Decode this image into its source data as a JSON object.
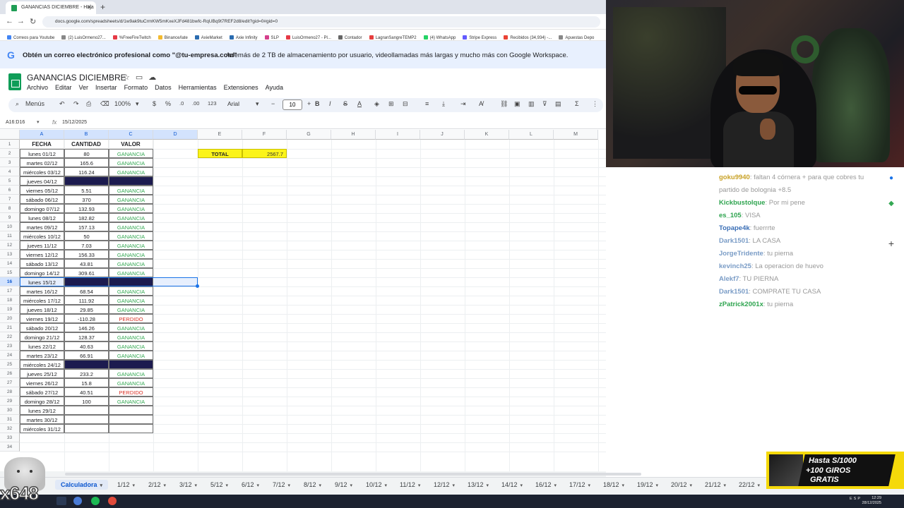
{
  "browser": {
    "tab_title": "GANANCIAS DICIEMBRE - Hoja",
    "url": "docs.google.com/spreadsheets/d/1w9ak9tuCrmKW5mKxeXJFd481bwfc-RqUBq9t7REF2d8/edit?gid=0#gid=0",
    "bookmarks": [
      {
        "label": "Correos para Youtube",
        "color": "#4285f4"
      },
      {
        "label": "(2) LuisOrmeno27...",
        "color": "#888888"
      },
      {
        "label": "%FreeFireTwitch",
        "color": "#e63946"
      },
      {
        "label": "Binance/late",
        "color": "#f3ba2f"
      },
      {
        "label": "AxieMarket",
        "color": "#2b6cb0"
      },
      {
        "label": "Axie Infinity",
        "color": "#2b6cb0"
      },
      {
        "label": "SLP",
        "color": "#d53f8c"
      },
      {
        "label": "LuisOrmeno27 - Pl...",
        "color": "#e63946"
      },
      {
        "label": "Contador",
        "color": "#666666"
      },
      {
        "label": "LagranSangreTEMP2",
        "color": "#e53e3e"
      },
      {
        "label": "(4) WhatsApp",
        "color": "#25d366"
      },
      {
        "label": "Stripe Express",
        "color": "#635bff"
      },
      {
        "label": "Recibidos (34,934) -...",
        "color": "#ea4335"
      },
      {
        "label": "Apuestas Depo",
        "color": "#888888"
      }
    ]
  },
  "promo": {
    "line1": "Obtén un correo electrónico profesional como \"@tu-empresa.com\"",
    "line2": "Además de 2 TB de almacenamiento por usuario, videollamadas más largas y mucho más con Google Workspace."
  },
  "sheets": {
    "title": "GANANCIAS DICIEMBRE",
    "menu": [
      "Archivo",
      "Editar",
      "Ver",
      "Insertar",
      "Formato",
      "Datos",
      "Herramientas",
      "Extensiones",
      "Ayuda"
    ],
    "toolbar": {
      "menus": "Menús",
      "zoom": "100%",
      "currency": "$",
      "percent": "%",
      "dec_less": ".0",
      "dec_more": ".00",
      "format_123": "123",
      "font": "Arial",
      "font_size": "10",
      "bold": "B",
      "italic": "I",
      "strike": "S",
      "text_color": "A"
    },
    "name_box": "A16:D16",
    "formula_value": "15/12/2025",
    "columns": [
      "A",
      "B",
      "C",
      "D",
      "E",
      "F",
      "G",
      "H",
      "I",
      "J",
      "K",
      "L",
      "M"
    ],
    "headers": {
      "fecha": "FECHA",
      "cantidad": "CANTIDAD",
      "valor": "VALOR"
    },
    "total_label": "TOTAL",
    "total_value": "2567.7",
    "rows": [
      {
        "fecha": "lunes 01/12",
        "cantidad": "80",
        "valor": "GANANCIA",
        "status": "gan"
      },
      {
        "fecha": "martes 02/12",
        "cantidad": "165.6",
        "valor": "GANANCIA",
        "status": "gan"
      },
      {
        "fecha": "miércoles 03/12",
        "cantidad": "116.24",
        "valor": "GANANCIA",
        "status": "gan"
      },
      {
        "fecha": "jueves 04/12",
        "cantidad": "",
        "valor": "",
        "status": "dark"
      },
      {
        "fecha": "viernes 05/12",
        "cantidad": "5.51",
        "valor": "GANANCIA",
        "status": "gan"
      },
      {
        "fecha": "sábado 06/12",
        "cantidad": "370",
        "valor": "GANANCIA",
        "status": "gan"
      },
      {
        "fecha": "domingo 07/12",
        "cantidad": "132.93",
        "valor": "GANANCIA",
        "status": "gan"
      },
      {
        "fecha": "lunes 08/12",
        "cantidad": "182.82",
        "valor": "GANANCIA",
        "status": "gan"
      },
      {
        "fecha": "martes 09/12",
        "cantidad": "157.13",
        "valor": "GANANCIA",
        "status": "gan"
      },
      {
        "fecha": "miércoles 10/12",
        "cantidad": "50",
        "valor": "GANANCIA",
        "status": "gan"
      },
      {
        "fecha": "jueves 11/12",
        "cantidad": "7.03",
        "valor": "GANANCIA",
        "status": "gan"
      },
      {
        "fecha": "viernes 12/12",
        "cantidad": "156.33",
        "valor": "GANANCIA",
        "status": "gan"
      },
      {
        "fecha": "sábado 13/12",
        "cantidad": "43.81",
        "valor": "GANANCIA",
        "status": "gan"
      },
      {
        "fecha": "domingo 14/12",
        "cantidad": "309.61",
        "valor": "GANANCIA",
        "status": "gan"
      },
      {
        "fecha": "lunes 15/12",
        "cantidad": "",
        "valor": "",
        "status": "dark"
      },
      {
        "fecha": "martes 16/12",
        "cantidad": "68.54",
        "valor": "GANANCIA",
        "status": "gan"
      },
      {
        "fecha": "miércoles 17/12",
        "cantidad": "111.92",
        "valor": "GANANCIA",
        "status": "gan"
      },
      {
        "fecha": "jueves 18/12",
        "cantidad": "29.85",
        "valor": "GANANCIA",
        "status": "gan"
      },
      {
        "fecha": "viernes 19/12",
        "cantidad": "-110.28",
        "valor": "PERDIDO",
        "status": "per"
      },
      {
        "fecha": "sábado 20/12",
        "cantidad": "146.26",
        "valor": "GANANCIA",
        "status": "gan"
      },
      {
        "fecha": "domingo 21/12",
        "cantidad": "128.37",
        "valor": "GANANCIA",
        "status": "gan"
      },
      {
        "fecha": "lunes 22/12",
        "cantidad": "40.63",
        "valor": "GANANCIA",
        "status": "gan"
      },
      {
        "fecha": "martes 23/12",
        "cantidad": "66.91",
        "valor": "GANANCIA",
        "status": "gan"
      },
      {
        "fecha": "miércoles 24/12",
        "cantidad": "",
        "valor": "",
        "status": "dark"
      },
      {
        "fecha": "jueves 25/12",
        "cantidad": "233.2",
        "valor": "GANANCIA",
        "status": "gan"
      },
      {
        "fecha": "viernes 26/12",
        "cantidad": "15.8",
        "valor": "GANANCIA",
        "status": "gan"
      },
      {
        "fecha": "sábado 27/12",
        "cantidad": "40.51",
        "valor": "PERDIDO",
        "status": "per"
      },
      {
        "fecha": "domingo 28/12",
        "cantidad": "100",
        "valor": "GANANCIA",
        "status": "gan"
      },
      {
        "fecha": "lunes 29/12",
        "cantidad": "",
        "valor": "",
        "status": "empty"
      },
      {
        "fecha": "martes 30/12",
        "cantidad": "",
        "valor": "",
        "status": "empty"
      },
      {
        "fecha": "miércoles 31/12",
        "cantidad": "",
        "valor": "",
        "status": "empty"
      }
    ],
    "row_numbers": [
      "1",
      "2",
      "3",
      "4",
      "5",
      "6",
      "7",
      "8",
      "9",
      "10",
      "11",
      "12",
      "13",
      "14",
      "15",
      "16",
      "17",
      "18",
      "19",
      "20",
      "21",
      "22",
      "23",
      "24",
      "25",
      "26",
      "27",
      "28",
      "29",
      "30",
      "31",
      "32",
      "33",
      "34"
    ],
    "sheet_tabs": [
      "Calculadora",
      "1/12",
      "2/12",
      "3/12",
      "5/12",
      "6/12",
      "7/12",
      "8/12",
      "9/12",
      "10/12",
      "11/12",
      "12/12",
      "13/12",
      "14/12",
      "16/12",
      "17/12",
      "18/12",
      "19/12",
      "20/12",
      "21/12",
      "22/12"
    ],
    "active_tab": "Calculadora"
  },
  "chat": [
    {
      "user": "goku9940",
      "color": "#c9a227",
      "msg": ": faltan 4 córnera + para que cobres tu"
    },
    {
      "user": "",
      "color": "#999999",
      "msg": "partido de bolognia +8.5"
    },
    {
      "user": "Kickbustolque",
      "color": "#2ea44f",
      "msg": ": Por mi pene"
    },
    {
      "user": "es_105",
      "color": "#2ea44f",
      "msg": ": VISA"
    },
    {
      "user": "Topape4k",
      "color": "#3b6fb6",
      "msg": ": fuerrrte"
    },
    {
      "user": "Dark1501",
      "color": "#7a9cc6",
      "msg": ": LA CASA"
    },
    {
      "user": "JorgeTridente",
      "color": "#7a9cc6",
      "msg": ": tu pierna"
    },
    {
      "user": "kevinch25",
      "color": "#7a9cc6",
      "msg": ": La operacion de huevo"
    },
    {
      "user": "Alekf7",
      "color": "#7a9cc6",
      "msg": ": TU PIERNA"
    },
    {
      "user": "Dark1501",
      "color": "#7a9cc6",
      "msg": ": COMPRATE TU CASA"
    },
    {
      "user": "zPatrick2001x",
      "color": "#2ea44f",
      "msg": ": tu pierna"
    }
  ],
  "ad": {
    "line1": "Hasta S/1000",
    "line2": "+100 GIROS",
    "line3": "GRATIS"
  },
  "overlay_text": "x648",
  "taskbar": {
    "lang": "ESP",
    "time": "12:29",
    "date": "28/12/2025"
  }
}
